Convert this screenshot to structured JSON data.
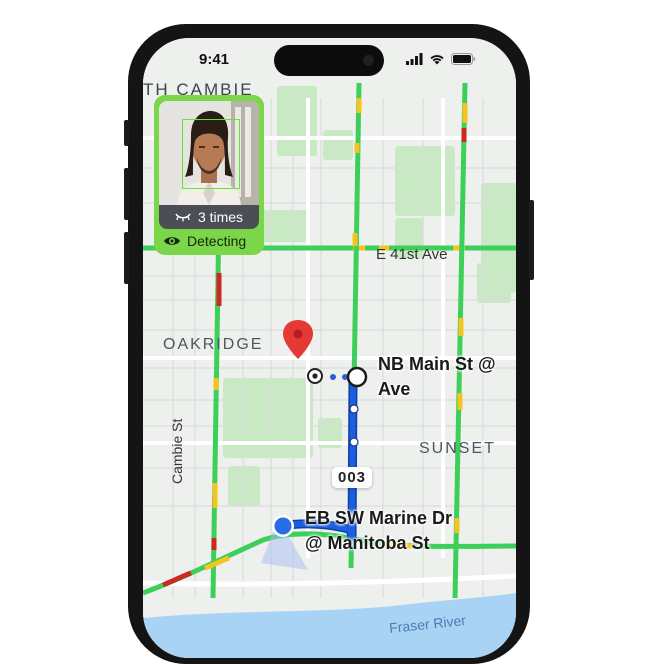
{
  "status_bar": {
    "time": "9:41"
  },
  "map": {
    "area_labels": {
      "south_cambie": "TH CAMBIE",
      "oakridge": "OAKRIDGE",
      "sunset": "SUNSET"
    },
    "street_labels": {
      "e41st": "E 41st Ave",
      "cambie": "Cambie St",
      "fraser": "Fraser River"
    }
  },
  "detection": {
    "blink_count": "3 times",
    "status": "Detecting"
  },
  "route": {
    "number": "003",
    "start_stop": {
      "line1": "EB SW Marine Dr",
      "line2": "@ Manitoba St"
    },
    "end_stop": {
      "line1": "NB Main St @",
      "line2": "Ave"
    }
  },
  "colors": {
    "route": "#1b5fe0",
    "traffic_green": "#3ccf5a",
    "traffic_yellow": "#f4c521",
    "traffic_red": "#c92a22",
    "park": "#c8e9c3",
    "water": "#a8d3f4",
    "detection_accent": "#7bd64a",
    "pin": "#e53935"
  }
}
